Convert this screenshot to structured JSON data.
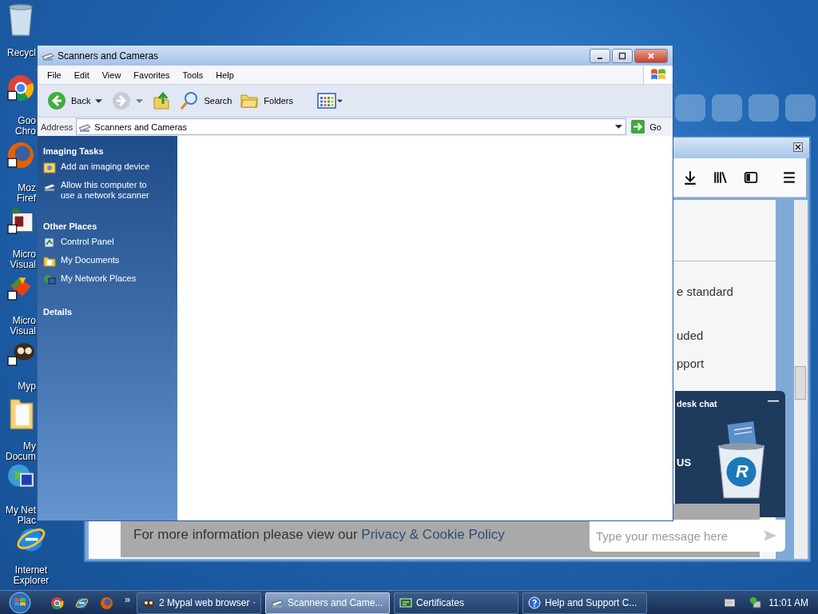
{
  "desktop_icons": [
    {
      "kind": "recycle",
      "lines": [
        "Recycl"
      ],
      "cut": true
    },
    {
      "kind": "chrome",
      "lines": [
        "Goo",
        "Chro"
      ],
      "cut": true
    },
    {
      "kind": "firefox",
      "lines": [
        "Moz",
        "Firef"
      ],
      "cut": true
    },
    {
      "kind": "studio",
      "lines": [
        "Micro",
        "Visual"
      ],
      "cut": true
    },
    {
      "kind": "visual",
      "lines": [
        "Micro",
        "Visual"
      ],
      "cut": true
    },
    {
      "kind": "mypal",
      "lines": [
        "Myp"
      ],
      "cut": true
    },
    {
      "kind": "folder",
      "lines": [
        "My",
        "Docum"
      ],
      "cut": true
    },
    {
      "kind": "network",
      "lines": [
        "My Net",
        "Plac"
      ],
      "cut": true
    },
    {
      "kind": "ie",
      "lines": [
        "Internet",
        "Explorer"
      ],
      "cut": false
    }
  ],
  "browser": {
    "page_lines": [
      "e standard",
      "uded",
      "pport"
    ],
    "chat": {
      "title": "desk chat",
      "minimize": "—",
      "text": "US",
      "logo_letter": "R",
      "placeholder": "Type your message here"
    },
    "banner": {
      "text": "For more information please view our",
      "link": "Privacy & Cookie Policy"
    }
  },
  "window": {
    "title": "Scanners and Cameras",
    "menu": [
      "File",
      "Edit",
      "View",
      "Favorites",
      "Tools",
      "Help"
    ],
    "toolbar": [
      {
        "kind": "back",
        "label": "Back"
      },
      {
        "kind": "forward"
      },
      {
        "kind": "up"
      },
      {
        "kind": "search",
        "label": "Search"
      },
      {
        "kind": "folders",
        "label": "Folders"
      },
      {
        "kind": "views"
      }
    ],
    "address": {
      "label": "Address",
      "value": "Scanners and Cameras",
      "go": "Go"
    },
    "task_pane": [
      {
        "title": "Imaging Tasks",
        "items": [
          {
            "kind": "add",
            "label": "Add an imaging device"
          },
          {
            "kind": "scanner",
            "label": "Allow this computer to use a network scanner"
          }
        ]
      },
      {
        "title": "Other Places",
        "items": [
          {
            "kind": "control",
            "label": "Control Panel"
          },
          {
            "kind": "documents",
            "label": "My Documents"
          },
          {
            "kind": "network",
            "label": "My Network Places"
          }
        ]
      },
      {
        "title": "Details"
      }
    ]
  },
  "taskbar": {
    "quick_launch": [
      {
        "kind": "chrome"
      },
      {
        "kind": "ie"
      },
      {
        "kind": "firefox"
      }
    ],
    "overflow": "»",
    "tasks": [
      {
        "kind": "mypal",
        "label": "2 Mypal web browser",
        "dropdown": true,
        "selected": false
      },
      {
        "kind": "scanner",
        "label": "Scanners and Came...",
        "selected": true
      },
      {
        "kind": "cert",
        "label": "Certificates",
        "selected": false
      },
      {
        "kind": "help",
        "label": "Help and Support C...",
        "selected": false
      }
    ],
    "clock": "11:01 AM"
  }
}
